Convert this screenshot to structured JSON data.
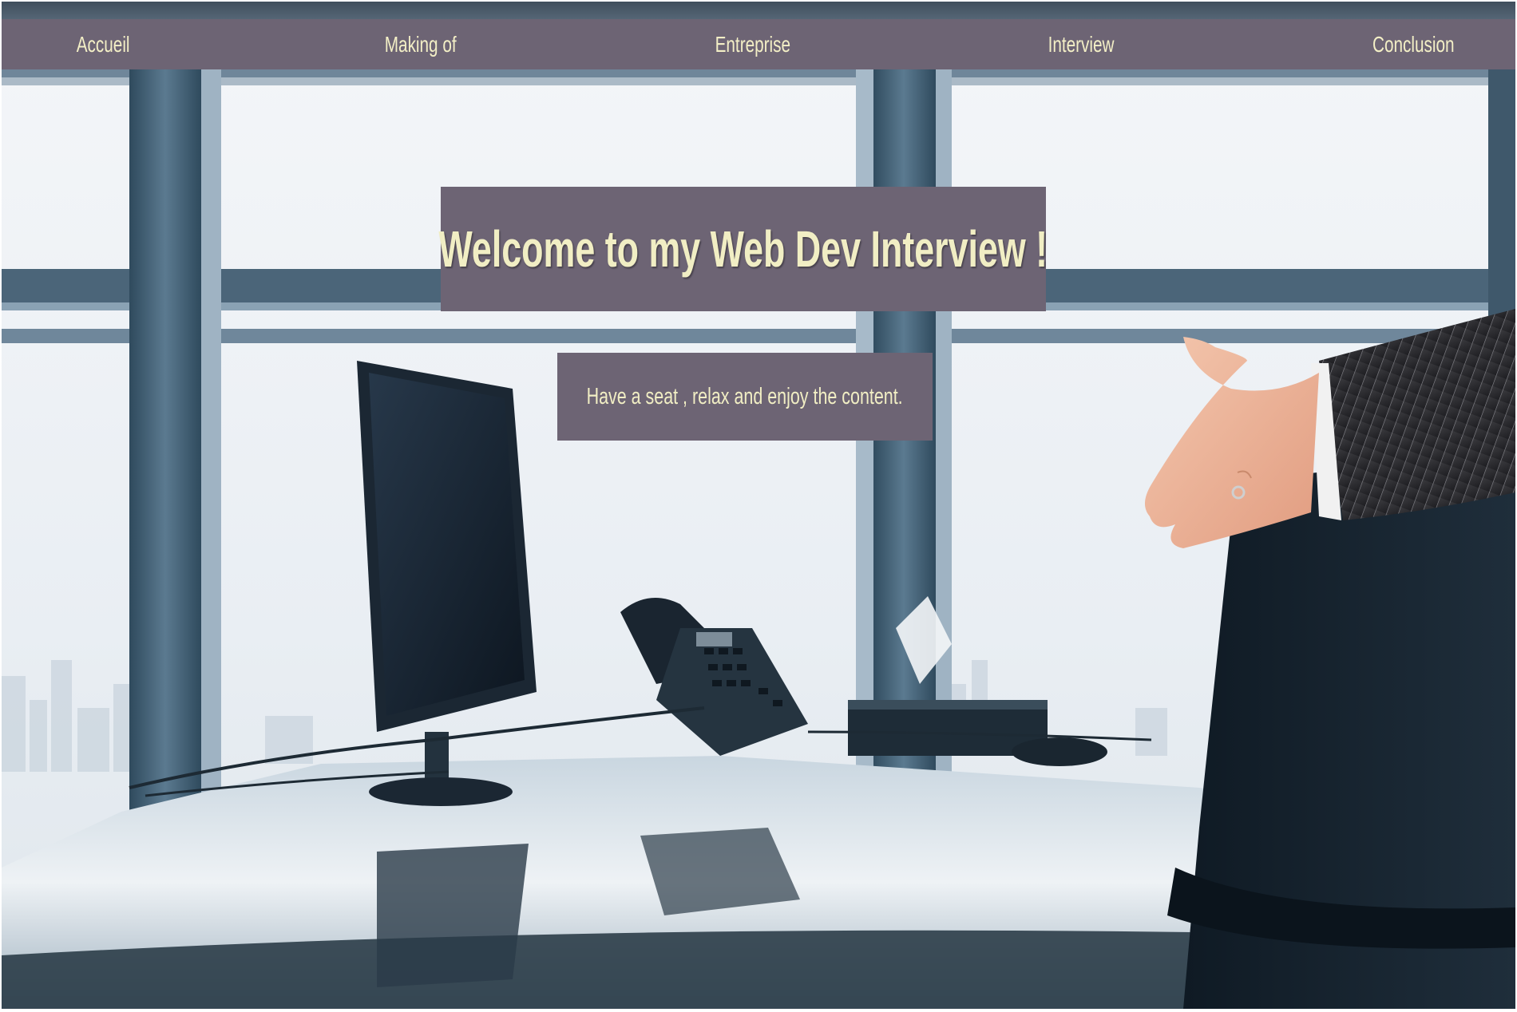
{
  "nav": {
    "items": [
      {
        "label": "Accueil"
      },
      {
        "label": "Making of"
      },
      {
        "label": "Entreprise"
      },
      {
        "label": "Interview"
      },
      {
        "label": "Conclusion"
      }
    ]
  },
  "hero": {
    "title": "Welcome to my Web Dev Interview !",
    "subtitle": "Have a seat , relax and enjoy the content."
  },
  "colors": {
    "nav_background": "#6d6474",
    "text_accent": "#f1eec4",
    "window_frame": "#3f5a6d",
    "sky": "#eef2f6"
  },
  "background_image": {
    "subject": "office desk with monitor and telephone in front of windows, hand extended for handshake"
  }
}
